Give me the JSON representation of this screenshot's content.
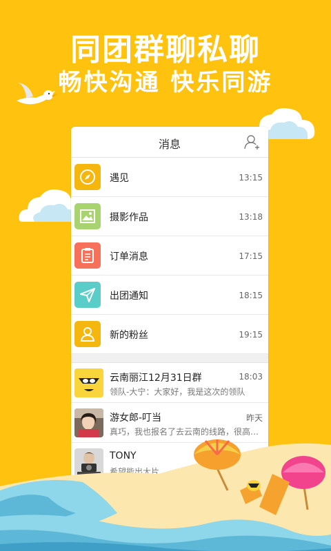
{
  "headline": {
    "line1": "同团群聊私聊",
    "line2": "畅快沟通 快乐同游"
  },
  "header": {
    "title": "消息"
  },
  "menu": [
    {
      "label": "遇见",
      "time": "13:15",
      "icon": "compass-icon",
      "color": "#F5B60E"
    },
    {
      "label": "摄影作品",
      "time": "13:18",
      "icon": "image-icon",
      "color": "#A8D46F"
    },
    {
      "label": "订单消息",
      "time": "17:15",
      "icon": "clipboard-icon",
      "color": "#F6705A"
    },
    {
      "label": "出团通知",
      "time": "18:15",
      "icon": "paper-plane-icon",
      "color": "#5ACDC9"
    },
    {
      "label": "新的粉丝",
      "time": "19:15",
      "icon": "user-icon",
      "color": "#F5B60E"
    }
  ],
  "chats": [
    {
      "name": "云南丽江12月31日群",
      "preview": "领队-大宁：大家好，我是这次的领队",
      "time": "18:03"
    },
    {
      "name": "游女郎-叮当",
      "preview": "真巧，我也报名了去云南的线路，很高…",
      "time": "昨天"
    },
    {
      "name": "TONY",
      "preview": "希望能出大片",
      "time": ""
    }
  ]
}
